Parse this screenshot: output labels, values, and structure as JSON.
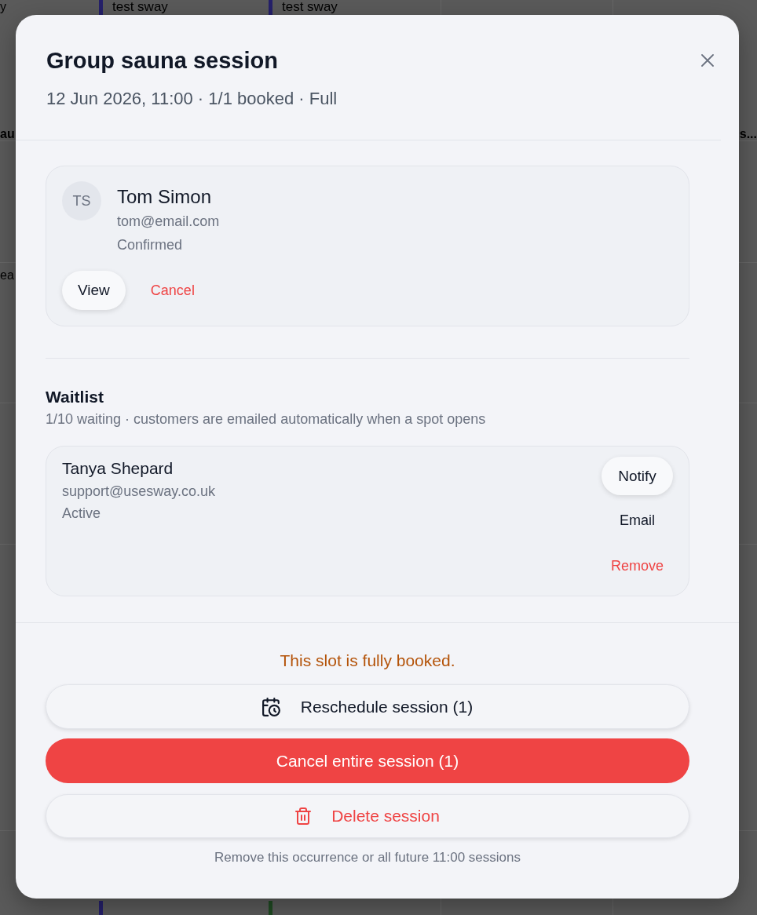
{
  "background": {
    "events": [
      {
        "title": "test sway",
        "color": "#25206a"
      },
      {
        "title": "test sway",
        "color": "#25206a"
      }
    ],
    "markers": [
      {
        "color": "#25206a"
      },
      {
        "color": "#1f4a22"
      }
    ],
    "clipped_texts": [
      "y",
      "au",
      "s...",
      "ea"
    ]
  },
  "dialog": {
    "title": "Group sauna session",
    "subtitle": "12 Jun 2026, 11:00 · 1/1 booked · Full"
  },
  "bookings": [
    {
      "initials": "TS",
      "name": "Tom Simon",
      "email": "tom@email.com",
      "status": "Confirmed",
      "actions": [
        {
          "label": "View",
          "kind": "pill"
        },
        {
          "label": "Cancel",
          "kind": "danger"
        }
      ]
    }
  ],
  "waitlist": {
    "title": "Waitlist",
    "description": "1/10 waiting · customers are emailed automatically when a spot opens",
    "entries": [
      {
        "name": "Tanya Shepard",
        "email": "support@usesway.co.uk",
        "status": "Active",
        "actions": [
          {
            "label": "Notify",
            "kind": "pill"
          },
          {
            "label": "Email",
            "kind": "link"
          },
          {
            "label": "Remove",
            "kind": "danger"
          }
        ]
      }
    ]
  },
  "notice": {
    "text": "This slot is fully booked.",
    "kind": "warning"
  },
  "actions": [
    {
      "label": "Reschedule session (1)",
      "kind": "reschedule"
    },
    {
      "label": "Cancel entire session (1)",
      "kind": "cancel"
    },
    {
      "label": "Delete session",
      "kind": "delete"
    }
  ],
  "footnote": "Remove this occurrence or all future 11:00 sessions"
}
